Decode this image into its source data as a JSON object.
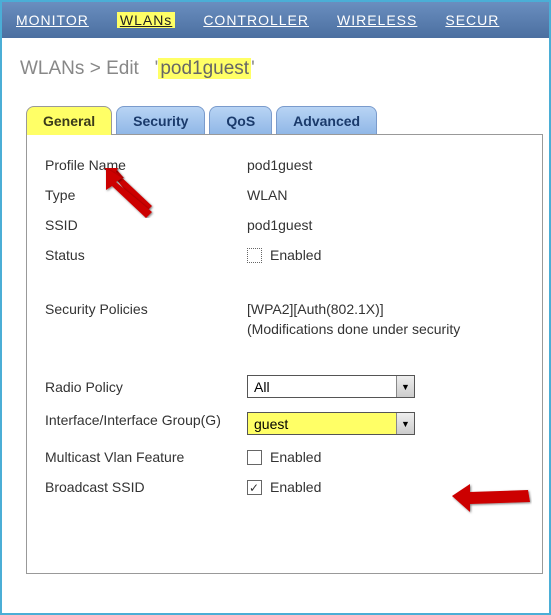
{
  "nav": {
    "monitor": "MONITOR",
    "wlans": "WLANs",
    "controller": "CONTROLLER",
    "wireless": "WIRELESS",
    "security": "SECUR"
  },
  "breadcrumb": {
    "root": "WLANs",
    "sep": ">",
    "action": "Edit",
    "quote_l": "'",
    "name": "pod1guest",
    "quote_r": "'"
  },
  "tabs": {
    "general": "General",
    "security": "Security",
    "qos": "QoS",
    "advanced": "Advanced"
  },
  "fields": {
    "profile_name_label": "Profile Name",
    "profile_name_value": "pod1guest",
    "type_label": "Type",
    "type_value": "WLAN",
    "ssid_label": "SSID",
    "ssid_value": "pod1guest",
    "status_label": "Status",
    "status_enabled_label": "Enabled",
    "security_policies_label": "Security Policies",
    "security_policies_value": "[WPA2][Auth(802.1X)]",
    "security_policies_note": "(Modifications done under security",
    "radio_policy_label": "Radio Policy",
    "radio_policy_value": "All",
    "interface_group_label": "Interface/Interface Group(G)",
    "interface_group_value": "guest",
    "multicast_label": "Multicast Vlan Feature",
    "multicast_enabled_label": "Enabled",
    "broadcast_label": "Broadcast SSID",
    "broadcast_enabled_label": "Enabled"
  }
}
